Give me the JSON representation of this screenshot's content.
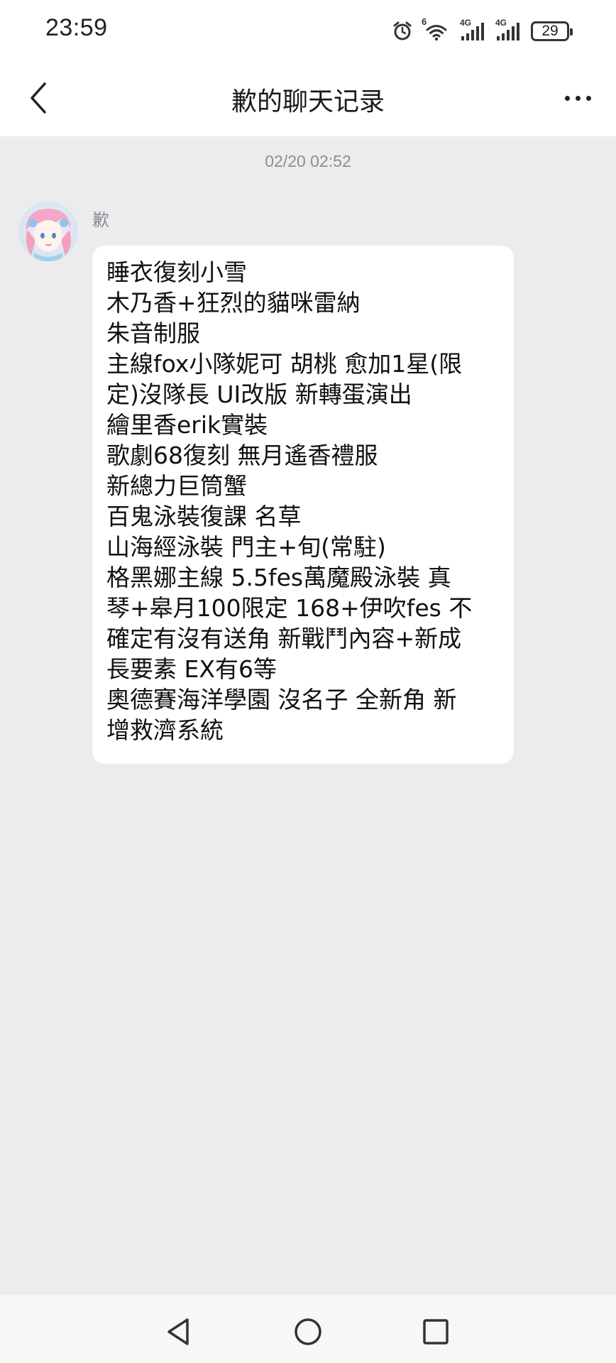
{
  "status_bar": {
    "time": "23:59",
    "battery": "29",
    "network_1": "4G",
    "network_2": "4G",
    "wifi_badge": "6"
  },
  "header": {
    "title": "歉的聊天记录",
    "back_icon": "chevron-left-icon",
    "more_icon": "more-horizontal-icon"
  },
  "chat": {
    "timestamp": "02/20 02:52",
    "sender_name": "歉",
    "message_lines": [
      "睡衣復刻小雪",
      "木乃香+狂烈的貓咪雷納",
      "朱音制服",
      "主線fox小隊妮可 胡桃 愈加1星(限",
      "定)沒隊長 UI改版 新轉蛋演出",
      "繪里香erik實裝",
      "歌劇68復刻 無月遙香禮服",
      "新總力巨筒蟹",
      "百鬼泳裝復課 名草",
      "山海經泳裝 門主+旬(常駐)",
      "格黑娜主線 5.5fes萬魔殿泳裝 真",
      "琴+皋月100限定 168+伊吹fes 不",
      "確定有沒有送角 新戰鬥內容+新成",
      "長要素 EX有6等",
      "奧德賽海洋學園 沒名子 全新角 新",
      "增救濟系統"
    ]
  },
  "bottom_nav": {
    "back_icon": "triangle-back-icon",
    "home_icon": "circle-home-icon",
    "recents_icon": "square-recents-icon"
  },
  "colors": {
    "background": "#ececee",
    "header": "#ffffff",
    "bubble": "#ffffff",
    "meta_text": "#8d8d92"
  }
}
